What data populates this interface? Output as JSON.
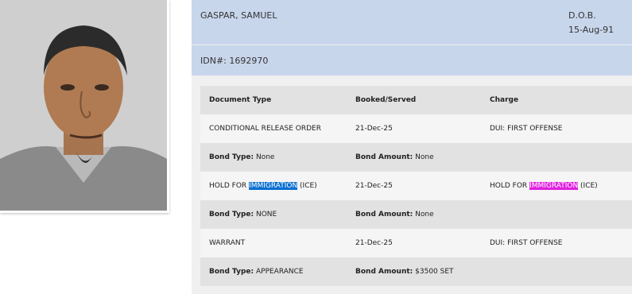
{
  "inmate": {
    "name": "GASPAR, SAMUEL",
    "dob_label": "D.O.B.",
    "dob": "15-Aug-91",
    "idn": "IDN#: 1692970"
  },
  "table": {
    "headers": [
      "Document Type",
      "Booked/Served",
      "Charge"
    ],
    "rows": [
      {
        "doc": "CONDITIONAL RELEASE ORDER",
        "date": "21-Dec-25",
        "charge": "DUI: FIRST OFFENSE",
        "bond_type_label": "Bond Type:",
        "bond_type": "None",
        "bond_amount_label": "Bond Amount:",
        "bond_amount": "None"
      },
      {
        "doc_pre": "HOLD FOR ",
        "doc_hl": "IMMIGRATION",
        "doc_post": " (ICE)",
        "date": "21-Dec-25",
        "charge_pre": "HOLD FOR ",
        "charge_hl": "IMMIGRATION",
        "charge_post": " (ICE)",
        "bond_type_label": "Bond Type:",
        "bond_type": "NONE",
        "bond_amount_label": "Bond Amount:",
        "bond_amount": "None"
      },
      {
        "doc": "WARRANT",
        "date": "21-Dec-25",
        "charge": "DUI: FIRST OFFENSE",
        "bond_type_label": "Bond Type:",
        "bond_type": "APPEARANCE",
        "bond_amount_label": "Bond Amount:",
        "bond_amount": "$3500 SET"
      }
    ]
  },
  "colors": {
    "header_band": "#c8d6ec",
    "highlight_blue": "#0a6fd0",
    "highlight_magenta": "#e020e0"
  }
}
